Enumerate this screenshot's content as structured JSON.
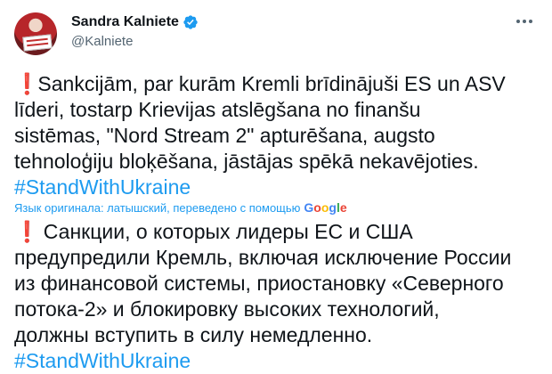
{
  "user": {
    "name": "Sandra Kalniete",
    "handle": "@Kalniete"
  },
  "tweet": {
    "original_lines": [
      "Sankcijām, par kurām Kremli brīdinājuši ES un ASV",
      "līderi, tostarp Krievijas atslēgšana no finanšu",
      "sistēmas, \"Nord Stream 2\" apturēšana, augsto",
      "tehnoloģiju bloķēšana, jāstājas spēkā nekavējoties."
    ],
    "original_hashtag": "#StandWithUkraine",
    "translation_note": "Язык оригинала: латышский, переведено с помощью",
    "translation_provider": "Google",
    "translated_lines": [
      "Санкции, о которых лидеры ЕС и США",
      "предупредили Кремль, включая исключение России",
      "из финансовой системы, приостановку «Северного",
      "потока-2» и блокировку высоких технологий,",
      "должны вступить в силу немедленно."
    ],
    "translated_hashtag": "#StandWithUkraine",
    "emphasis_glyph": "❗"
  },
  "colors": {
    "link": "#1d9bf0",
    "text": "#0f1419",
    "secondary": "#536471",
    "emphasis": "#e0245e"
  },
  "icons": [
    "avatar",
    "verified-badge-icon",
    "more-options-icon",
    "exclamation-icon",
    "google-logo"
  ]
}
